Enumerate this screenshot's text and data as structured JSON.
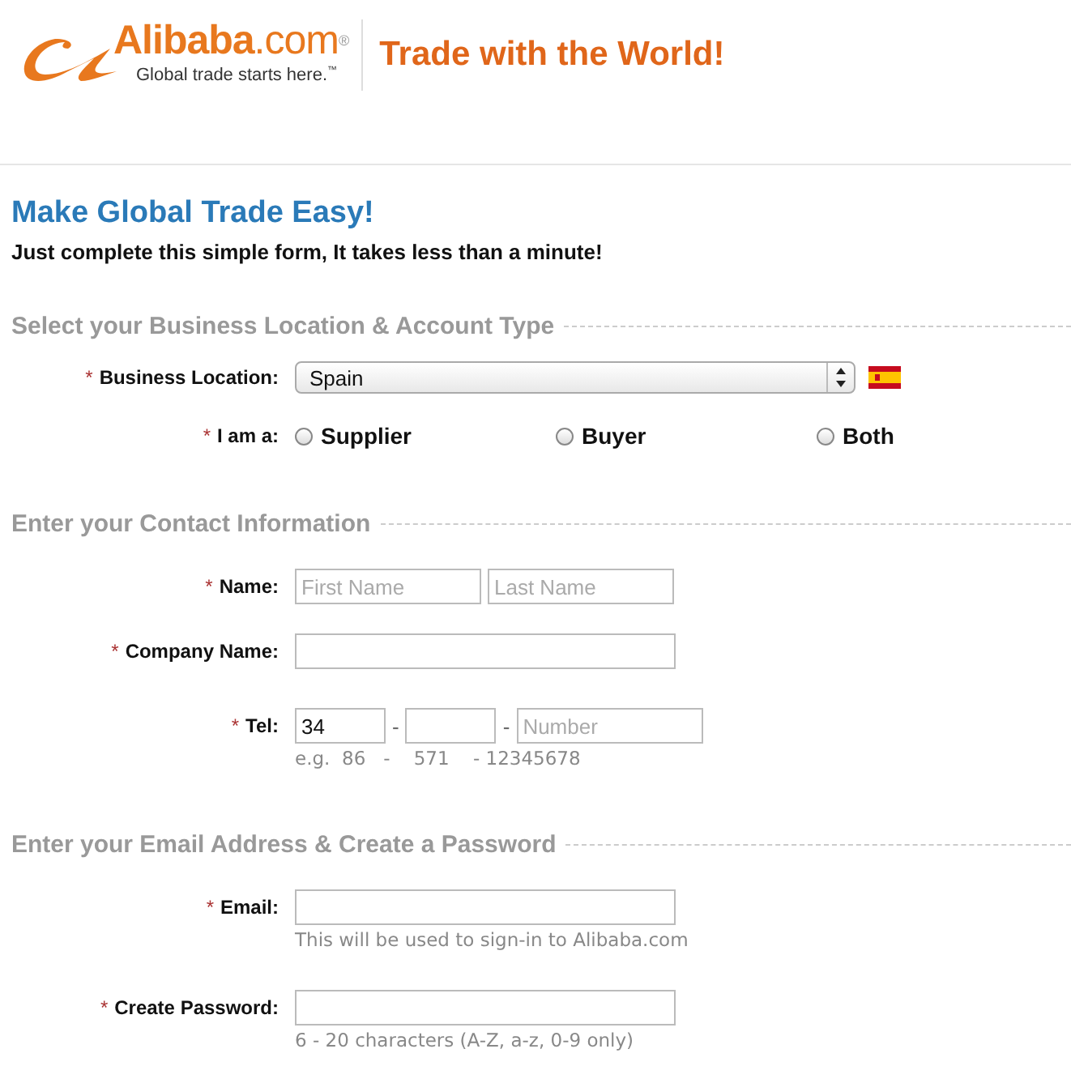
{
  "header": {
    "brand": "**Alibaba**.com$^{®}$",
    "tagline": "Global trade starts here.$^{™}$",
    "slogan": "Trade with the World!"
  },
  "title": "Make Global Trade Easy!",
  "subtitle": "Just complete this simple form, It takes less than a minute!",
  "sections": [
    {
      "heading": "Select your Business Location & Account Type",
      "rows": [
        {
          "kind": "select",
          "required_mark": "*",
          "label": "Business Location:",
          "value": "Spain"
        },
        {
          "kind": "radios",
          "required_mark": "*",
          "label": "I am a:",
          "options": [
            {
              "label": "Supplier",
              "selected": false
            },
            {
              "label": "Buyer",
              "selected": false
            },
            {
              "label": "Both",
              "selected": false
            }
          ]
        }
      ]
    },
    {
      "heading": "Enter your Contact Information",
      "rows": [
        {
          "kind": "inputs",
          "required_mark": "*",
          "label": "Name:",
          "inputs": [
            {
              "placeholder": "First Name"
            },
            {
              "placeholder": "Last Name"
            }
          ]
        },
        {
          "kind": "text",
          "required_mark": "*",
          "label": "Company Name:"
        },
        {
          "kind": "phone",
          "required_mark": "*",
          "label": "Tel:",
          "inputs": [
            {
              "value": "34"
            },
            {
              "separator": "-"
            },
            {
              "separator": "-",
              "placeholder": "Number"
            }
          ],
          "hint": "e.g.  86   -    571    - 12345678"
        }
      ]
    },
    {
      "heading": "Enter your Email Address & Create a Password",
      "rows": [
        {
          "kind": "text",
          "required_mark": "*",
          "label": "Email:",
          "hint": "This will be used to sign-in to Alibaba.com"
        },
        {
          "kind": "text",
          "required_mark": "*",
          "label": "Create Password:",
          "hint": "6 - 20 characters (A-Z, a-z, 0-9 only)"
        }
      ]
    }
  ]
}
